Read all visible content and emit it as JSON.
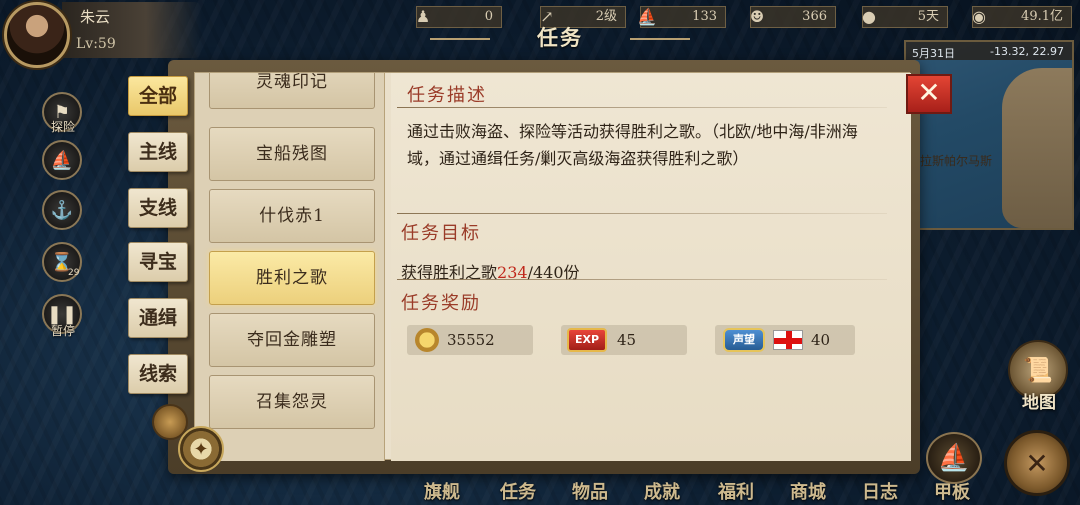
{
  "player": {
    "name": "朱云",
    "level": "Lv:59"
  },
  "resources": [
    {
      "icon": "pawn-icon",
      "glyph": "♟",
      "value": "0"
    },
    {
      "icon": "rank-arrow-icon",
      "glyph": "↗",
      "value": "2级"
    },
    {
      "icon": "ship-icon",
      "glyph": "⛵",
      "value": "133"
    },
    {
      "icon": "crew-icon",
      "glyph": "☻",
      "value": "366"
    },
    {
      "icon": "bread-icon",
      "glyph": "●",
      "value": "5天"
    },
    {
      "icon": "gold-coin-icon",
      "glyph": "◉",
      "value": "49.1亿"
    }
  ],
  "window_title": "任务",
  "minimap": {
    "date": "5月31日",
    "coords": "-13.32, 22.97",
    "place": "拉斯帕尔马斯"
  },
  "side_buttons": [
    {
      "name": "explore",
      "glyph": "⚑",
      "label": "探险"
    },
    {
      "name": "fleet",
      "glyph": "⛵",
      "label": ""
    },
    {
      "name": "anchor",
      "glyph": "⚓",
      "label": ""
    },
    {
      "name": "hourglass",
      "glyph": "⌛",
      "label": ""
    },
    {
      "name": "pause",
      "glyph": "❚❚",
      "label": "暂停"
    }
  ],
  "hourglass_badge": "29",
  "categories": [
    "全部",
    "主线",
    "支线",
    "寻宝",
    "通缉",
    "线索"
  ],
  "tasks": [
    "灵魂印记",
    "宝船残图",
    "什伐赤1",
    "胜利之歌",
    "夺回金雕塑",
    "召集怨灵"
  ],
  "detail": {
    "desc_title": "任务描述",
    "description": "通过击败海盗、探险等活动获得胜利之歌。（北欧/地中海/非洲海域，通过通缉任务/剿灭高级海盗获得胜利之歌）",
    "target_title": "任务目标",
    "target_prefix": "获得胜利之歌",
    "target_current": "234",
    "target_suffix": "/440份",
    "reward_title": "任务奖励",
    "rewards": {
      "coins": "35552",
      "exp_label": "EXP",
      "exp": "45",
      "reputation_label": "声望",
      "reputation": "40"
    }
  },
  "close_label": "✕",
  "bottom_nav": [
    "旗舰",
    "任务",
    "物品",
    "成就",
    "福利",
    "商城",
    "日志",
    "甲板"
  ],
  "map_label": "地图",
  "colors": {
    "accent_red": "#c0281c",
    "title_red": "#9a3b28",
    "active_tab": "#e9c86a",
    "close_red": "#e34534"
  }
}
